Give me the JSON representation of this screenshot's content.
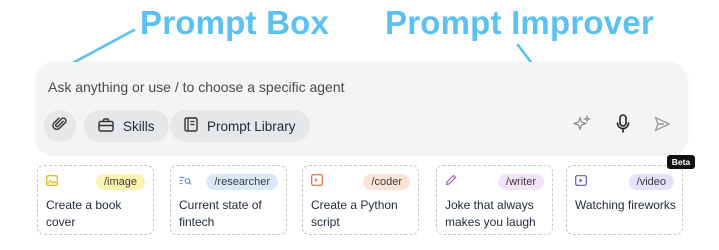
{
  "annotations": {
    "prompt_box": "Prompt Box",
    "prompt_improver": "Prompt Improver"
  },
  "prompt": {
    "placeholder": "Ask anything or use / to choose a specific agent",
    "value": ""
  },
  "toolbar": {
    "skills_label": "Skills",
    "library_label": "Prompt Library"
  },
  "icons": {
    "attach": "paperclip-icon",
    "skills": "briefcase-icon",
    "library": "book-icon",
    "improve": "sparkle-icon",
    "mic": "microphone-icon",
    "send": "send-icon"
  },
  "agents": [
    {
      "tag": "/image",
      "text": "Create a book cover",
      "tag_bg": "#fdf3b0",
      "tag_fg": "#3b3b3b",
      "icon_color": "#e8b923",
      "icon": "image-icon"
    },
    {
      "tag": "/researcher",
      "text": "Current state of fintech",
      "tag_bg": "#dbe8f7",
      "tag_fg": "#3b3b3b",
      "icon_color": "#6b8fd1",
      "icon": "search-list-icon"
    },
    {
      "tag": "/coder",
      "text": "Create a Python script",
      "tag_bg": "#fbe4d6",
      "tag_fg": "#3b3b3b",
      "icon_color": "#d96b3a",
      "icon": "code-icon"
    },
    {
      "tag": "/writer",
      "text": "Joke that always makes you laugh",
      "tag_bg": "#f3e3f8",
      "tag_fg": "#3b3b3b",
      "icon_color": "#a455c8",
      "icon": "pencil-icon"
    },
    {
      "tag": "/video",
      "text": "Watching fireworks",
      "tag_bg": "#e6e0fb",
      "tag_fg": "#3b3b3b",
      "icon_color": "#6a4fd6",
      "icon": "video-icon"
    }
  ],
  "beta_label": "Beta"
}
